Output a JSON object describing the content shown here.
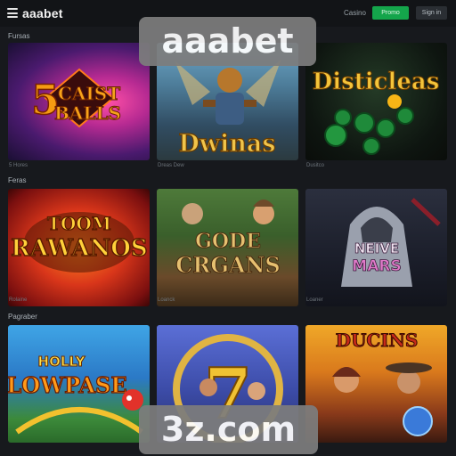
{
  "header": {
    "logo": "aaabet",
    "link": "Casino",
    "primary_button": "Promo",
    "secondary_button": "Sign in"
  },
  "sections": [
    {
      "title": "Fursas",
      "games": [
        {
          "title": "5 CAIST BALLS",
          "caption": "5 Hores"
        },
        {
          "title": "Dwinas",
          "caption": "Dreas Dew"
        },
        {
          "title": "Disticleas",
          "caption": "Dusitco"
        }
      ]
    },
    {
      "title": "Feras",
      "games": [
        {
          "title": "TOOM RAWANOS",
          "caption": "Rolaine"
        },
        {
          "title": "GODE CRGANS",
          "caption": "Loanck"
        },
        {
          "title": "NEIVE MARS",
          "caption": "Loaner"
        }
      ]
    },
    {
      "title": "Pagraber",
      "games": [
        {
          "title": "HOLLY LOWPASE",
          "caption": ""
        },
        {
          "title": "7",
          "caption": ""
        },
        {
          "title": "DUCINS",
          "caption": ""
        }
      ]
    }
  ],
  "watermark": {
    "top": "aaabet",
    "bottom": "3z.com"
  },
  "colors": {
    "accent_green": "#14a54b",
    "background": "#17191d"
  }
}
